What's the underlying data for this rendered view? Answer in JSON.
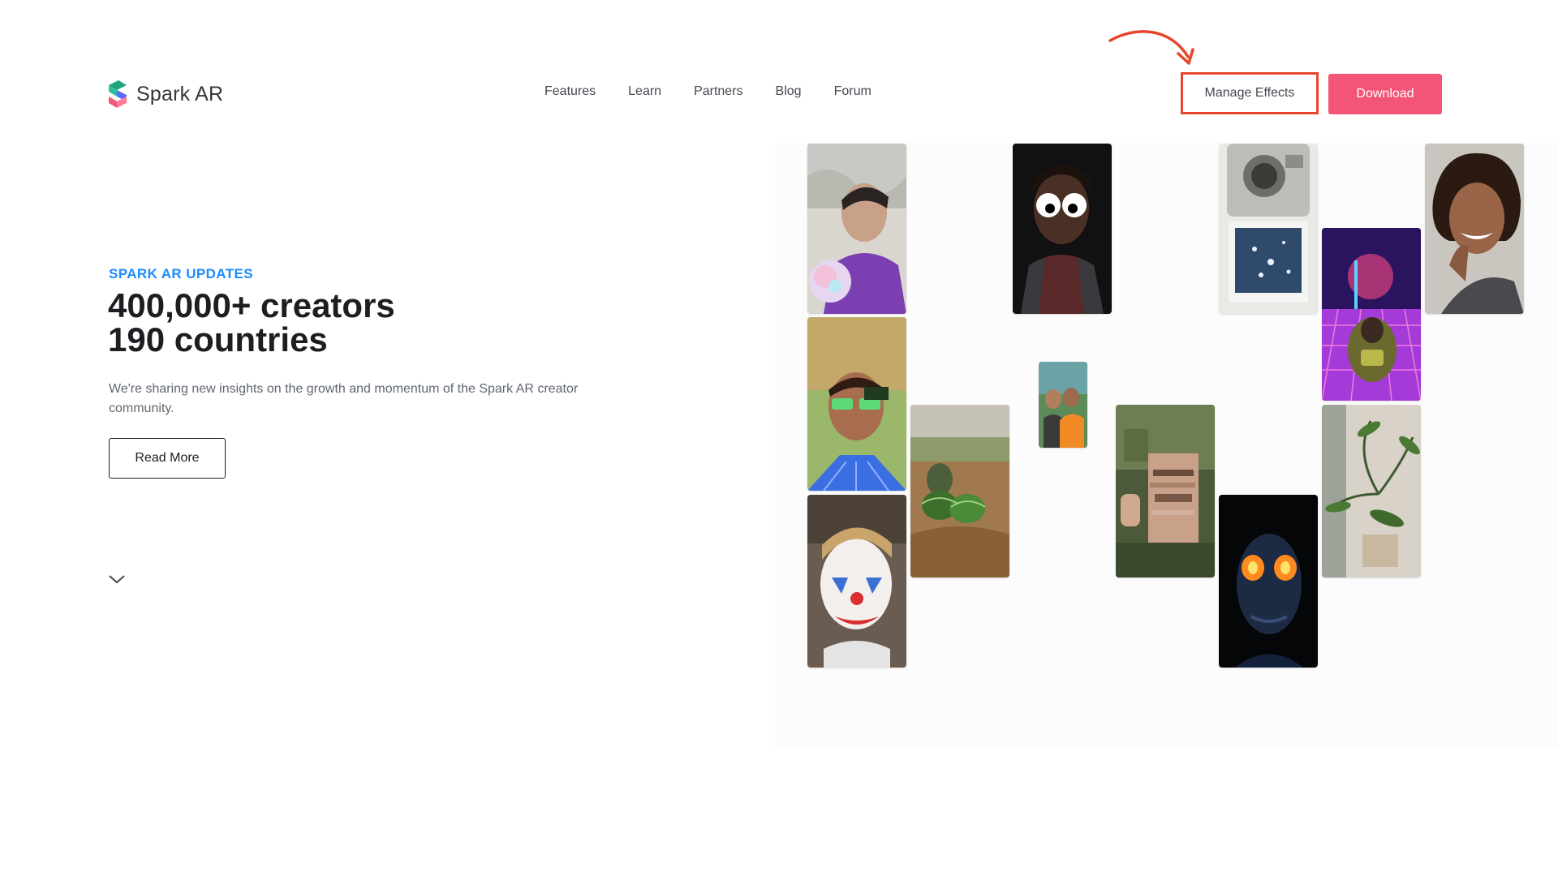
{
  "brand": {
    "name": "Spark AR",
    "logo_icon": "spark-ar-logo-icon",
    "colors": {
      "accent_pink": "#f25576",
      "eyebrow_blue": "#1a8cff",
      "annotation_red": "#e8452c"
    }
  },
  "nav": {
    "items": [
      {
        "label": "Features"
      },
      {
        "label": "Learn"
      },
      {
        "label": "Partners"
      },
      {
        "label": "Blog"
      },
      {
        "label": "Forum"
      }
    ]
  },
  "header": {
    "manage_effects_label": "Manage Effects",
    "download_label": "Download"
  },
  "hero": {
    "eyebrow": "SPARK AR UPDATES",
    "headline_line1": "400,000+ creators",
    "headline_line2": "190 countries",
    "description": "We're sharing new insights on the growth and momentum of the Spark AR creator community.",
    "read_more_label": "Read More",
    "scroll_icon": "chevron-down-icon"
  },
  "gallery": {
    "tiles": [
      {
        "name": "effect-tile-bubble-portrait"
      },
      {
        "name": "effect-tile-game-glasses"
      },
      {
        "name": "effect-tile-clown-face"
      },
      {
        "name": "effect-tile-watermelons"
      },
      {
        "name": "effect-tile-googly-eyes"
      },
      {
        "name": "effect-tile-two-friends"
      },
      {
        "name": "effect-tile-pixel-face"
      },
      {
        "name": "effect-tile-camera-photo"
      },
      {
        "name": "effect-tile-glowing-eyes"
      },
      {
        "name": "effect-tile-retro-racer"
      },
      {
        "name": "effect-tile-plant"
      },
      {
        "name": "effect-tile-smiling-woman"
      }
    ]
  }
}
